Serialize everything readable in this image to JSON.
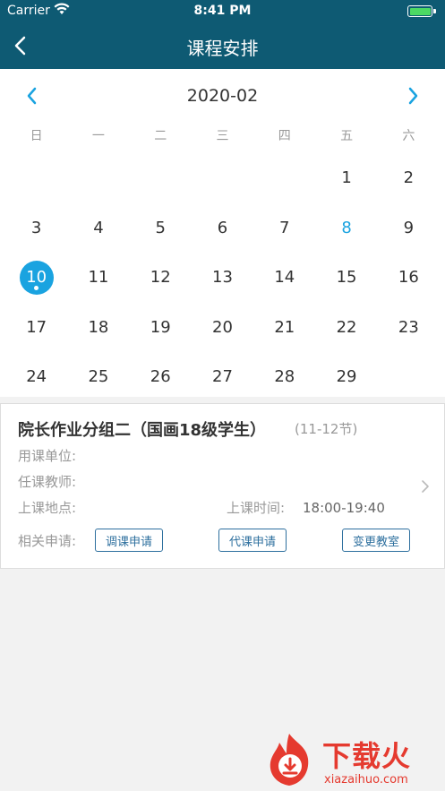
{
  "status_bar": {
    "carrier": "Carrier",
    "time": "8:41 PM"
  },
  "nav": {
    "title": "课程安排"
  },
  "calendar": {
    "month": "2020-02",
    "weekdays": [
      "日",
      "一",
      "二",
      "三",
      "四",
      "五",
      "六"
    ],
    "days": [
      "",
      "",
      "",
      "",
      "",
      "1",
      "2",
      "3",
      "4",
      "5",
      "6",
      "7",
      "8",
      "9",
      "10",
      "11",
      "12",
      "13",
      "14",
      "15",
      "16",
      "17",
      "18",
      "19",
      "20",
      "21",
      "22",
      "23",
      "24",
      "25",
      "26",
      "27",
      "28",
      "29",
      ""
    ],
    "today": "8",
    "selected": "10",
    "accent_color": "#1aa3e0"
  },
  "course": {
    "title": "院长作业分组二（国画18级学生）",
    "sessions": "(11-12节)",
    "unit_label": "用课单位:",
    "unit_value": "",
    "teacher_label": "任课教师:",
    "teacher_value": "",
    "location_label": "上课地点:",
    "location_value": "",
    "time_label": "上课时间:",
    "time_value": "18:00-19:40",
    "requests_label": "相关申请:",
    "buttons": [
      "调课申请",
      "代课申请",
      "变更教室"
    ]
  },
  "watermark": {
    "brand": "下载火",
    "domain": "xiazaihuo.com"
  },
  "colors": {
    "header": "#0e5a73",
    "button_border": "#2d6f9e"
  }
}
